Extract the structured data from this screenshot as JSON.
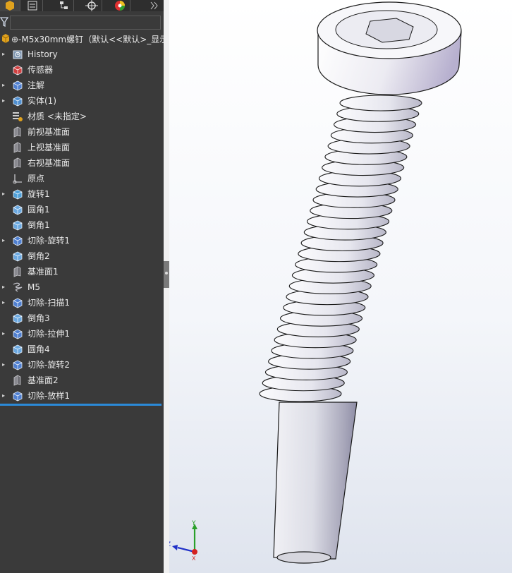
{
  "app": {
    "name": "SolidWorks"
  },
  "tabs": [
    {
      "name": "feature-manager",
      "icon": "feature-tree-icon",
      "active": true
    },
    {
      "name": "property-manager",
      "icon": "property-list-icon"
    },
    {
      "name": "configuration-manager",
      "icon": "config-tree-icon"
    },
    {
      "name": "dimxpert-manager",
      "icon": "crosshair-target-icon"
    },
    {
      "name": "display-manager",
      "icon": "color-wheel-icon"
    },
    {
      "name": "more",
      "icon": "chevron-right-icon"
    }
  ],
  "filter": {
    "icon": "funnel-icon"
  },
  "tree": {
    "root": {
      "label": "⊕-M5x30mm螺钉（默认<<默认>_显示"
    },
    "items": [
      {
        "label": "History",
        "icon": "history-icon",
        "expandable": true
      },
      {
        "label": "传感器",
        "icon": "sensor-icon",
        "expandable": false
      },
      {
        "label": "注解",
        "icon": "annotation-icon",
        "expandable": true
      },
      {
        "label": "实体(1)",
        "icon": "solid-bodies-icon",
        "expandable": true
      },
      {
        "label": "材质 <未指定>",
        "icon": "material-icon",
        "expandable": false
      },
      {
        "label": "前视基准面",
        "icon": "plane-icon",
        "expandable": false
      },
      {
        "label": "上视基准面",
        "icon": "plane-icon",
        "expandable": false
      },
      {
        "label": "右视基准面",
        "icon": "plane-icon",
        "expandable": false
      },
      {
        "label": "原点",
        "icon": "origin-icon",
        "expandable": false
      },
      {
        "label": "旋转1",
        "icon": "revolve-icon",
        "expandable": true
      },
      {
        "label": "圆角1",
        "icon": "fillet-icon",
        "expandable": false
      },
      {
        "label": "倒角1",
        "icon": "chamfer-icon",
        "expandable": false
      },
      {
        "label": "切除-旋转1",
        "icon": "cut-revolve-icon",
        "expandable": true
      },
      {
        "label": "倒角2",
        "icon": "chamfer-icon",
        "expandable": false
      },
      {
        "label": "基准面1",
        "icon": "plane-icon",
        "expandable": false
      },
      {
        "label": "M5",
        "icon": "helix-icon",
        "expandable": true
      },
      {
        "label": "切除-扫描1",
        "icon": "cut-sweep-icon",
        "expandable": true
      },
      {
        "label": "倒角3",
        "icon": "chamfer-icon",
        "expandable": false
      },
      {
        "label": "切除-拉伸1",
        "icon": "cut-extrude-icon",
        "expandable": true
      },
      {
        "label": "圆角4",
        "icon": "fillet-icon",
        "expandable": false
      },
      {
        "label": "切除-旋转2",
        "icon": "cut-revolve-icon",
        "expandable": true
      },
      {
        "label": "基准面2",
        "icon": "plane-icon",
        "expandable": false
      },
      {
        "label": "切除-放样1",
        "icon": "cut-loft-icon",
        "expandable": true
      }
    ]
  },
  "triad": {
    "x_label": "X",
    "y_label": "Y",
    "z_label": "Z"
  },
  "colors": {
    "panel_bg": "#3a3a3a",
    "selection_line": "#2b8ad8",
    "x_axis": "#d42020",
    "y_axis": "#2aa02a",
    "z_axis": "#2030c8"
  }
}
